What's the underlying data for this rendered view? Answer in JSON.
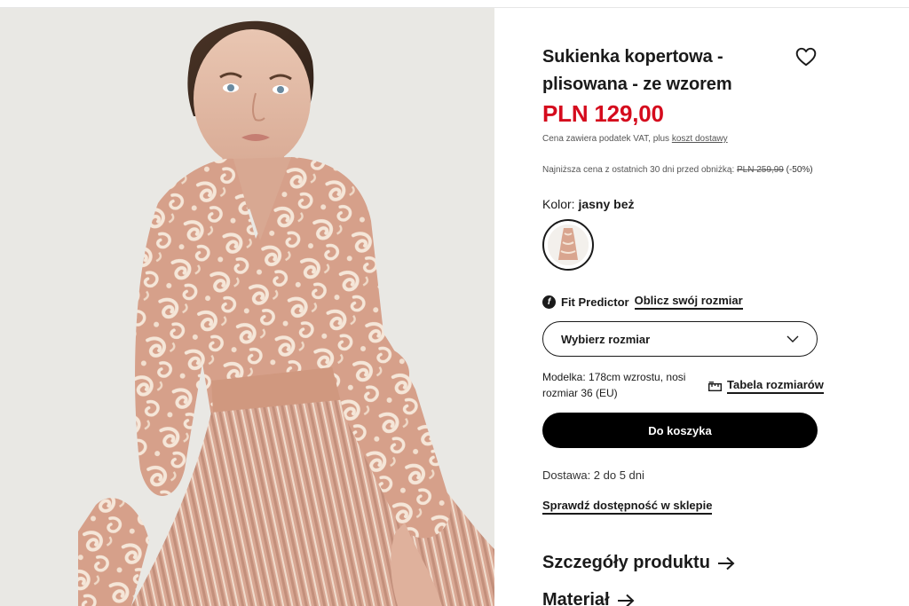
{
  "product": {
    "title": "Sukienka kopertowa - plisowana - ze wzorem",
    "price": "PLN 129,00",
    "vat_text": "Cena zawiera podatek VAT, plus ",
    "vat_link": "koszt dostawy",
    "lowest_text": "Najniższa cena z ostatnich 30 dni przed obniżką: ",
    "lowest_old_price": "PLN 259,99",
    "lowest_discount": "(-50%)",
    "color_label": "Kolor: ",
    "color_value": "jasny beż",
    "wishlist_icon": "heart-icon"
  },
  "fit": {
    "icon": "fit-predictor-icon",
    "label": "Fit Predictor",
    "link": "Oblicz swój rozmiar"
  },
  "size_select": {
    "placeholder": "Wybierz rozmiar",
    "icon": "chevron-down-icon"
  },
  "model_info": "Modelka: 178cm wzrostu, nosi rozmiar 36 (EU)",
  "size_table": {
    "icon": "ruler-icon",
    "label": "Tabela rozmiarów"
  },
  "cart_button": "Do koszyka",
  "delivery": "Dostawa: 2 do 5 dni",
  "store_link": "Sprawdź dostępność w sklepie",
  "sections": {
    "details": "Szczegóły produktu",
    "material": "Materiał"
  },
  "colors": {
    "price_red": "#d50b1d",
    "text": "#1a1a1a",
    "button_bg": "#000000",
    "dress_base": "#d9a58f",
    "dress_pattern": "#f4e4d6"
  }
}
